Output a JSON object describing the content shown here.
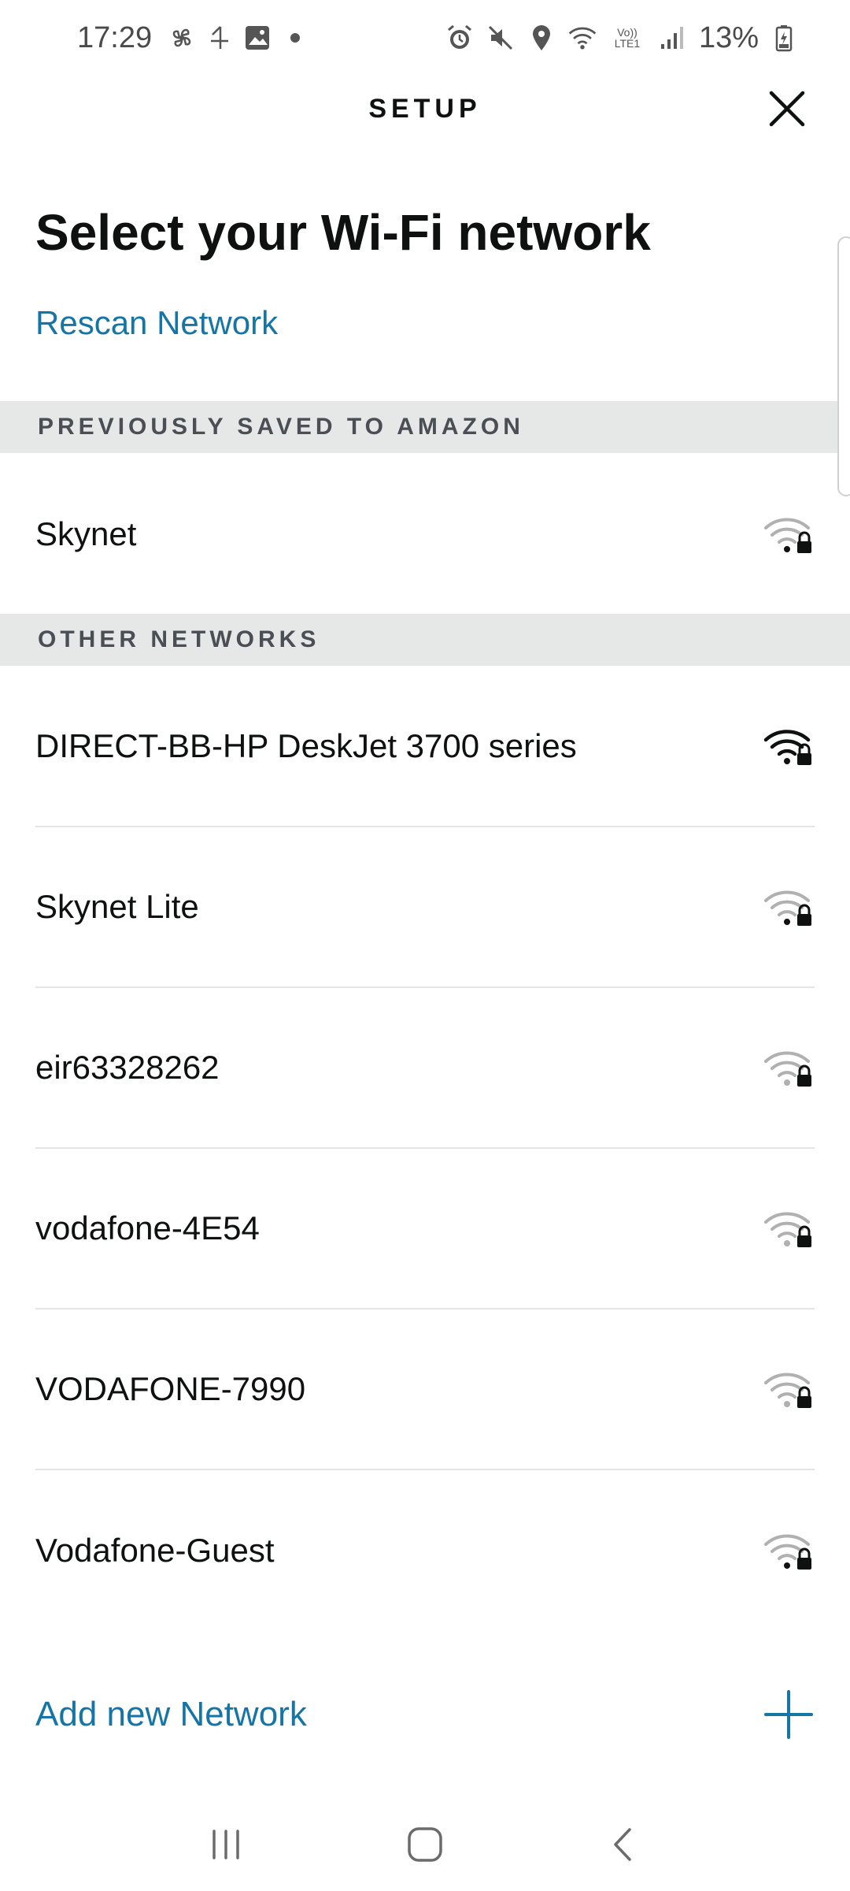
{
  "status_bar": {
    "time": "17:29",
    "battery_percent": "13%",
    "left_icons": [
      "fan-icon",
      "channel4-icon",
      "gallery-icon",
      "notification-dot-icon"
    ],
    "right_icons": [
      "alarm-icon",
      "mute-icon",
      "location-icon",
      "wifi-status-icon",
      "volte-icon",
      "signal-icon",
      "battery-icon"
    ],
    "volte_label": "Vo)) LTE1"
  },
  "header": {
    "title": "SETUP",
    "close_icon": "close-icon"
  },
  "main": {
    "title": "Select your Wi-Fi network",
    "rescan_label": "Rescan Network"
  },
  "sections": {
    "saved_header": "PREVIOUSLY SAVED TO AMAZON",
    "other_header": "OTHER NETWORKS"
  },
  "saved_networks": [
    {
      "name": "Skynet",
      "signal": "weak-locked"
    }
  ],
  "other_networks": [
    {
      "name": "DIRECT-BB-HP DeskJet 3700 series",
      "signal": "strong-locked"
    },
    {
      "name": "Skynet Lite",
      "signal": "weak-locked"
    },
    {
      "name": "eir63328262",
      "signal": "weak-locked"
    },
    {
      "name": "vodafone-4E54",
      "signal": "weak-locked"
    },
    {
      "name": "VODAFONE-7990",
      "signal": "weak-locked"
    },
    {
      "name": "Vodafone-Guest",
      "signal": "weak-locked"
    }
  ],
  "add_network": {
    "label": "Add new Network",
    "icon": "plus-icon"
  },
  "nav_bar": {
    "buttons": [
      "recents-icon",
      "home-icon",
      "back-icon"
    ]
  },
  "colors": {
    "link": "#1475a6",
    "section_bg": "#e6e7e7",
    "text": "#0f1111",
    "signal_strong": "#0f1111",
    "signal_weak": "#b0b0b0"
  }
}
